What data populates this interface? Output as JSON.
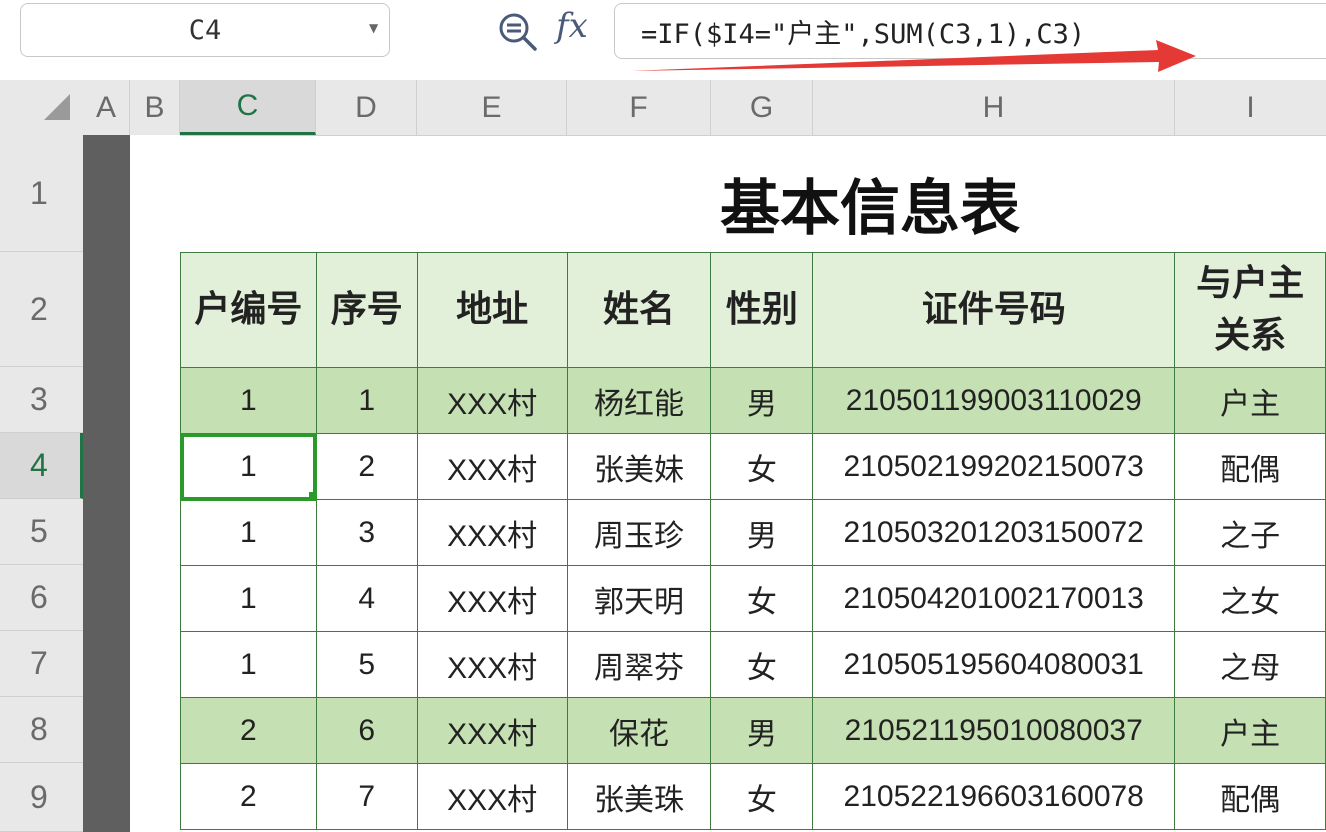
{
  "formula_bar": {
    "name_box": "C4",
    "formula": "=IF($I4=\"户主\",SUM(C3,1),C3)",
    "zoom_icon": "zoom-formula-icon",
    "fx_label": "fx"
  },
  "columns": [
    "A",
    "B",
    "C",
    "D",
    "E",
    "F",
    "G",
    "H",
    "I"
  ],
  "selected_column": "C",
  "rows": [
    "1",
    "2",
    "3",
    "4",
    "5",
    "6",
    "7",
    "8",
    "9"
  ],
  "selected_row": "4",
  "sheet": {
    "title": "基本信息表",
    "headers": [
      "户编号",
      "序号",
      "地址",
      "姓名",
      "性别",
      "证件号码",
      "与户主关系"
    ],
    "data_rows": [
      {
        "hh": "1",
        "seq": "1",
        "addr": "XXX村",
        "name": "杨红能",
        "gender": "男",
        "id": "210501199003110029",
        "rel": "户主"
      },
      {
        "hh": "1",
        "seq": "2",
        "addr": "XXX村",
        "name": "张美妹",
        "gender": "女",
        "id": "210502199202150073",
        "rel": "配偶"
      },
      {
        "hh": "1",
        "seq": "3",
        "addr": "XXX村",
        "name": "周玉珍",
        "gender": "男",
        "id": "210503201203150072",
        "rel": "之子"
      },
      {
        "hh": "1",
        "seq": "4",
        "addr": "XXX村",
        "name": "郭天明",
        "gender": "女",
        "id": "210504201002170013",
        "rel": "之女"
      },
      {
        "hh": "1",
        "seq": "5",
        "addr": "XXX村",
        "name": "周翠芬",
        "gender": "女",
        "id": "210505195604080031",
        "rel": "之母"
      },
      {
        "hh": "2",
        "seq": "6",
        "addr": "XXX村",
        "name": "保花",
        "gender": "男",
        "id": "210521195010080037",
        "rel": "户主"
      },
      {
        "hh": "2",
        "seq": "7",
        "addr": "XXX村",
        "name": "张美珠",
        "gender": "女",
        "id": "210522196603160078",
        "rel": "配偶"
      }
    ]
  },
  "colors": {
    "household_head_fill": "#c5e0b3",
    "header_fill": "#e2efd9",
    "selection": "#2a9a2a",
    "annotation_arrow": "#e53935"
  }
}
